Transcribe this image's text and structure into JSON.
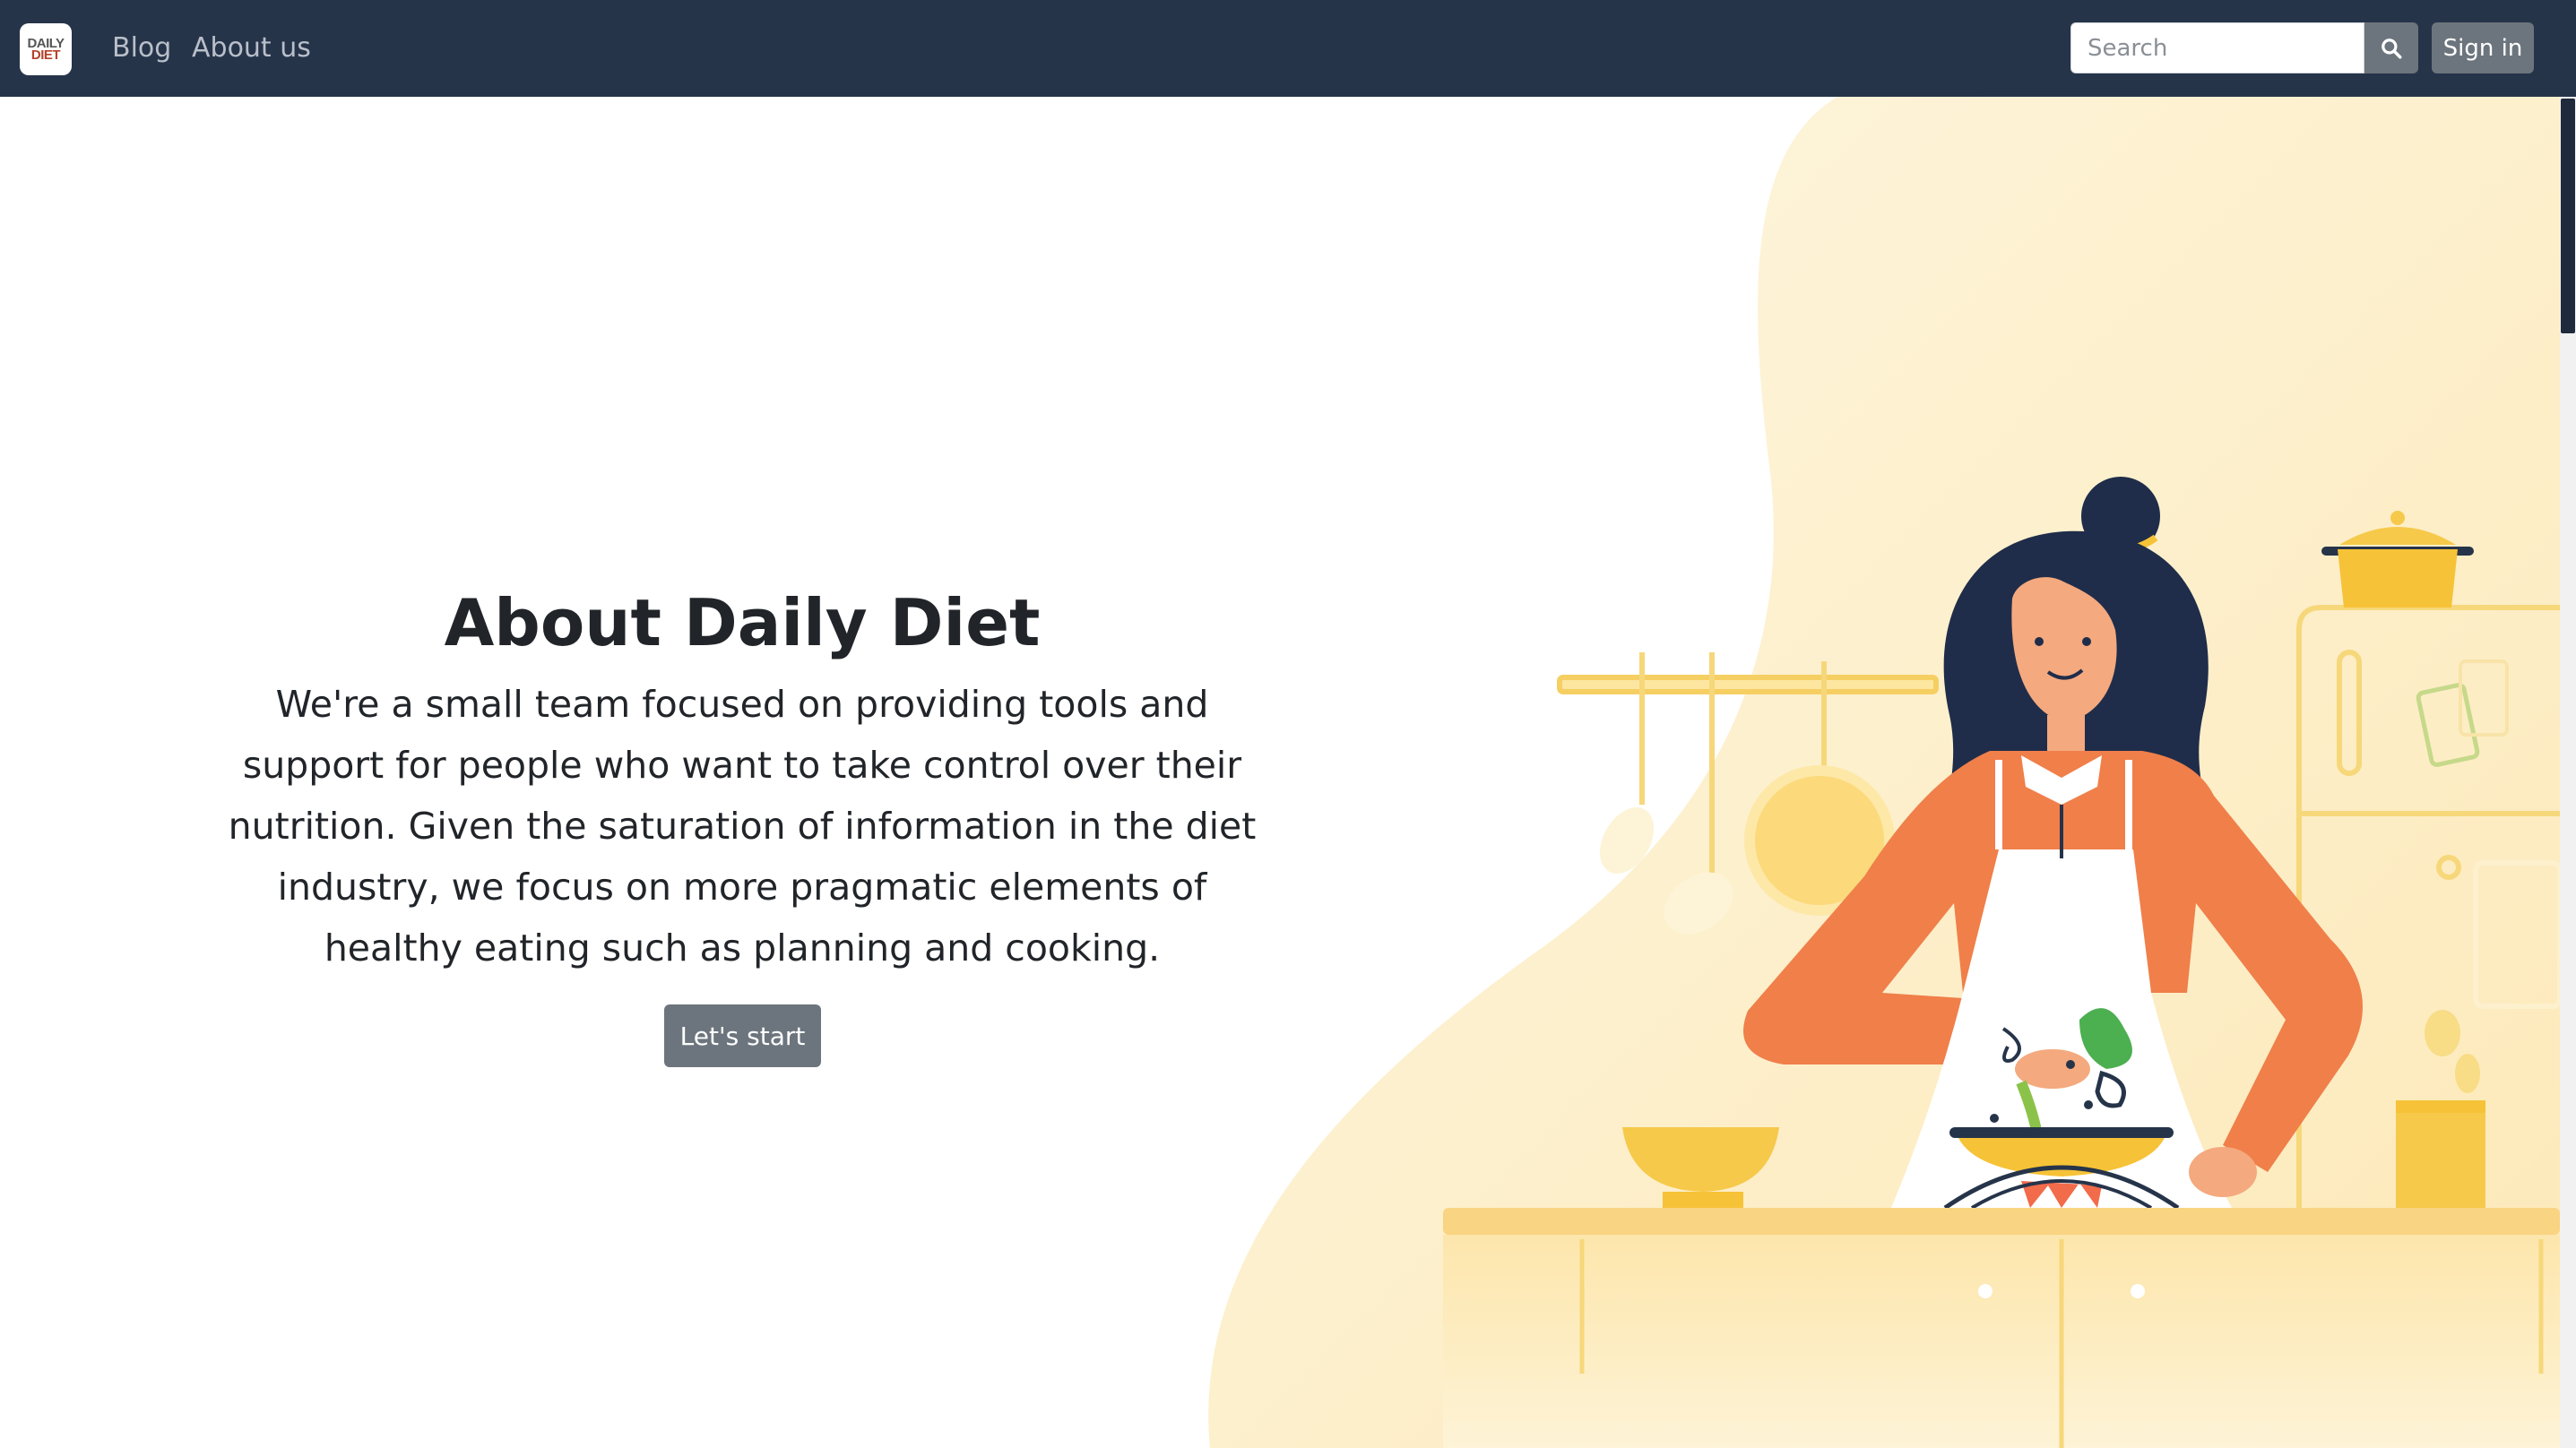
{
  "navbar": {
    "logo": {
      "line1": "DAILY",
      "line2": "DIET"
    },
    "links": [
      {
        "label": "Blog"
      },
      {
        "label": "About us"
      }
    ],
    "search": {
      "placeholder": "Search",
      "value": ""
    },
    "signin_label": "Sign in"
  },
  "hero": {
    "title": "About Daily Diet",
    "body": "We're a small team focused on providing tools and support for people who want to take control over their nutrition. Given the saturation of information in the diet industry, we focus on more pragmatic elements of healthy eating such as planning and cooking.",
    "cta_label": "Let's start"
  },
  "colors": {
    "navbar_bg": "#26344a",
    "button_gray": "#6c757d",
    "text_dark": "#212529",
    "nav_link": "#b9bfc9",
    "illustration_bg": "#fdf1cf",
    "apron_shirt": "#f07f4a",
    "hair": "#1f2d4a",
    "accent_yellow": "#f6c94a"
  },
  "icons": {
    "search": "search-icon",
    "logo": "logo-icon"
  }
}
